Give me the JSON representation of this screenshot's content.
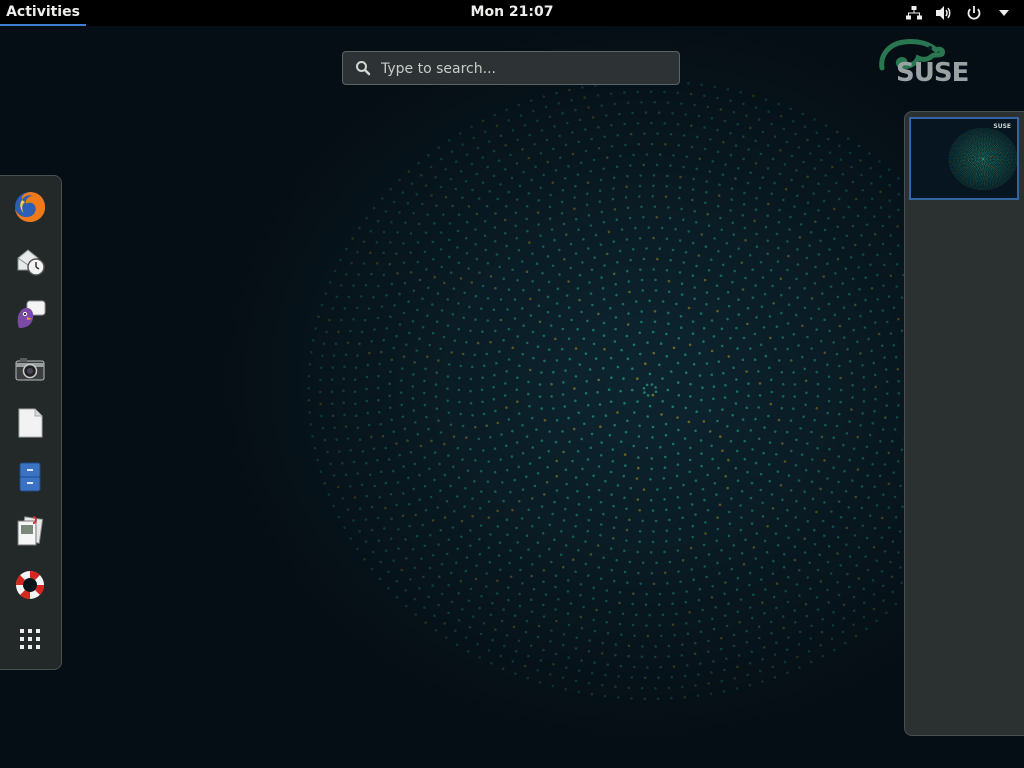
{
  "top_bar": {
    "activities_label": "Activities",
    "clock": "Mon 21:07",
    "status_icons": [
      "network-wired-icon",
      "volume-icon",
      "power-icon",
      "dropdown-arrow-icon"
    ]
  },
  "search": {
    "placeholder": "Type to search..."
  },
  "branding": {
    "logo_text": "SUSE"
  },
  "dash": {
    "items": [
      {
        "icon": "firefox-icon",
        "app": "Firefox"
      },
      {
        "icon": "evolution-mail-icon",
        "app": "Evolution"
      },
      {
        "icon": "pidgin-icon",
        "app": "Pidgin"
      },
      {
        "icon": "camera-icon",
        "app": "Camera"
      },
      {
        "icon": "document-icon",
        "app": "Documents"
      },
      {
        "icon": "file-cabinet-icon",
        "app": "Files"
      },
      {
        "icon": "shotwell-icon",
        "app": "Photos"
      },
      {
        "icon": "help-lifebuoy-icon",
        "app": "Help"
      },
      {
        "icon": "show-applications-icon",
        "app": "Show Applications"
      }
    ]
  },
  "workspaces": {
    "count": 1,
    "active_index": 0
  },
  "colors": {
    "accent": "#3b7ecf",
    "wallpaper_dots": "#1f8f7a",
    "wallpaper_dots_gold": "#8a7a2a",
    "suse_green": "#30ba78"
  }
}
